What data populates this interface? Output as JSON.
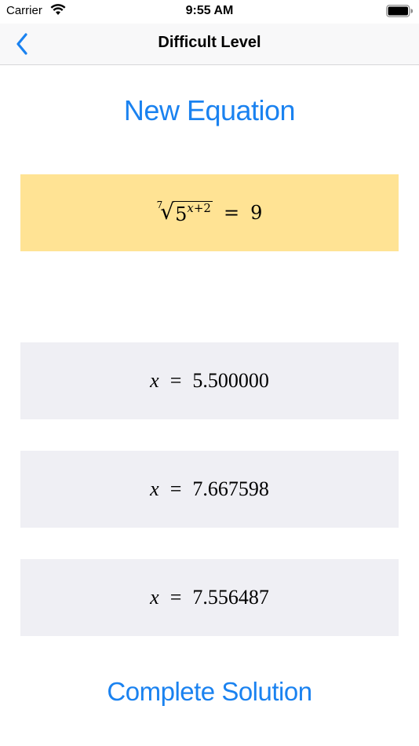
{
  "status": {
    "carrier": "Carrier",
    "time": "9:55 AM"
  },
  "nav": {
    "title": "Difficult Level"
  },
  "buttons": {
    "new_equation": "New Equation",
    "complete_solution": "Complete Solution"
  },
  "equation": {
    "root_index": "7",
    "base": "5",
    "exponent_var": "x",
    "exponent_rest": "+2",
    "equals": "=",
    "rhs": "9"
  },
  "answers": [
    {
      "var": "x",
      "equals": "=",
      "value": "5.500000"
    },
    {
      "var": "x",
      "equals": "=",
      "value": "7.667598"
    },
    {
      "var": "x",
      "equals": "=",
      "value": "7.556487"
    }
  ],
  "colors": {
    "accent": "#1a82f0",
    "equation_bg": "#ffe394",
    "answer_bg": "#efeff4"
  }
}
